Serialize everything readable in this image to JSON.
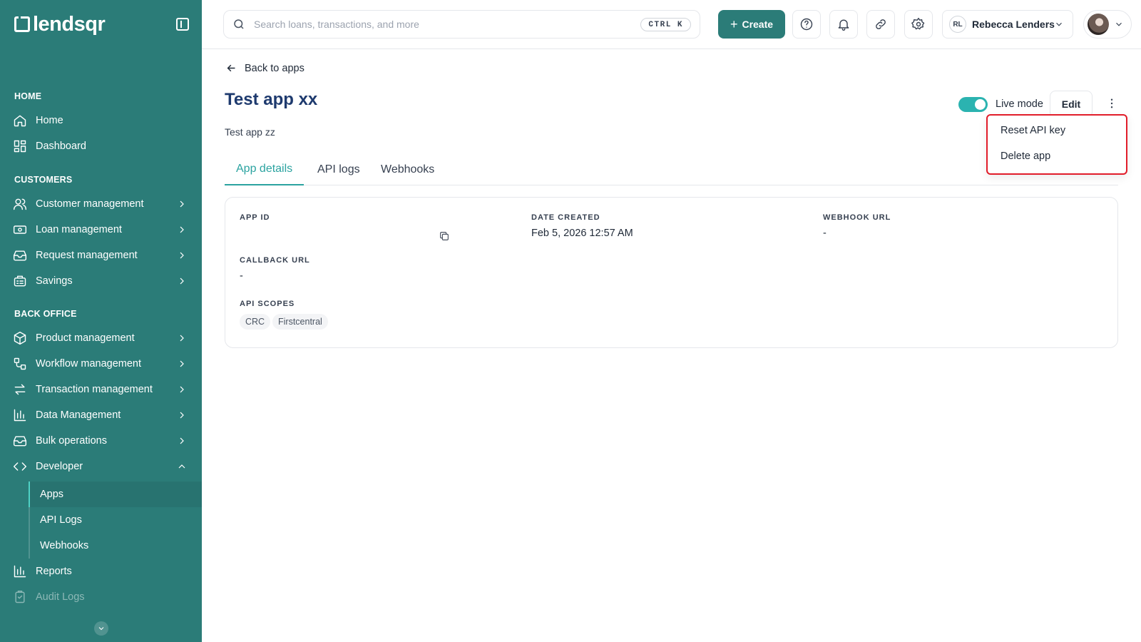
{
  "brand": {
    "name": "lendsqr"
  },
  "sidebar": {
    "sections": {
      "home": "HOME",
      "customers": "CUSTOMERS",
      "back_office": "BACK OFFICE"
    },
    "items": {
      "home": "Home",
      "dashboard": "Dashboard",
      "customer_management": "Customer management",
      "loan_management": "Loan management",
      "request_management": "Request management",
      "savings": "Savings",
      "product_management": "Product management",
      "workflow_management": "Workflow management",
      "transaction_management": "Transaction management",
      "data_management": "Data Management",
      "bulk_operations": "Bulk operations",
      "developer": "Developer",
      "reports": "Reports",
      "audit_logs": "Audit Logs"
    },
    "developer_sub": {
      "apps": "Apps",
      "api_logs": "API Logs",
      "webhooks": "Webhooks"
    }
  },
  "topbar": {
    "search_placeholder": "Search loans, transactions, and more",
    "shortcut": "CTRL K",
    "create_label": "Create",
    "user_initials": "RL",
    "user_name": "Rebecca Lenders"
  },
  "page": {
    "back_label": "Back to apps",
    "title": "Test app xx",
    "description": "Test app zz",
    "live_mode_label": "Live mode",
    "live_mode_on": true,
    "edit_label": "Edit"
  },
  "menu": {
    "reset_api_key": "Reset API key",
    "delete_app": "Delete app"
  },
  "tabs": [
    "App details",
    "API logs",
    "Webhooks"
  ],
  "details": {
    "app_id_label": "APP ID",
    "app_id_value": "",
    "date_created_label": "DATE CREATED",
    "date_created_value": "Feb 5, 2026 12:57 AM",
    "webhook_url_label": "WEBHOOK URL",
    "webhook_url_value": "-",
    "callback_url_label": "CALLBACK URL",
    "callback_url_value": "-",
    "api_scopes_label": "API SCOPES",
    "api_scopes": [
      "CRC",
      "Firstcentral"
    ]
  },
  "colors": {
    "sidebar": "#2b7c78",
    "accent": "#2ba3a0",
    "title": "#1e3a6e",
    "highlight": "#e11d2a"
  }
}
